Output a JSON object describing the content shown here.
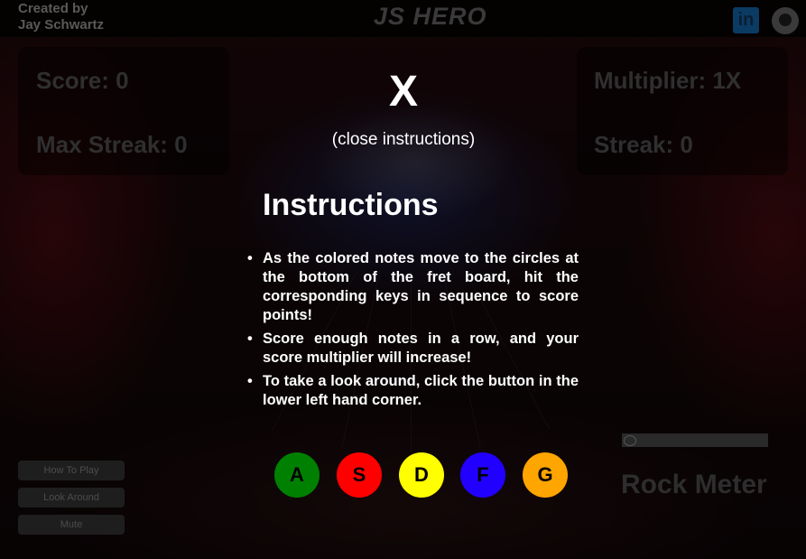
{
  "header": {
    "credit_line1": "Created by",
    "credit_line2": "Jay Schwartz",
    "logo": "JS HERO",
    "linkedin_icon": "in",
    "github_icon": "github-icon"
  },
  "stats": {
    "score": "Score: 0",
    "max_streak": "Max Streak: 0",
    "multiplier": "Multiplier: 1X",
    "streak": "Streak: 0"
  },
  "sidebar": {
    "how_to_play": "How To Play",
    "look_around": "Look Around",
    "mute": "Mute"
  },
  "rock_meter": {
    "label": "Rock Meter"
  },
  "instructions": {
    "close_x": "X",
    "close_text": "(close instructions)",
    "title": "Instructions",
    "items": [
      "As the colored notes move to the circles at the bottom of the fret board, hit the corresponding keys in sequence to score points!",
      "Score enough notes in a row, and your score multiplier will increase!",
      "To take a look around, click the button in the lower left hand corner."
    ]
  },
  "keys": [
    {
      "label": "A",
      "color": "#008000"
    },
    {
      "label": "S",
      "color": "#ff0000"
    },
    {
      "label": "D",
      "color": "#ffff00"
    },
    {
      "label": "F",
      "color": "#2200ff"
    },
    {
      "label": "G",
      "color": "#ffa500"
    }
  ]
}
